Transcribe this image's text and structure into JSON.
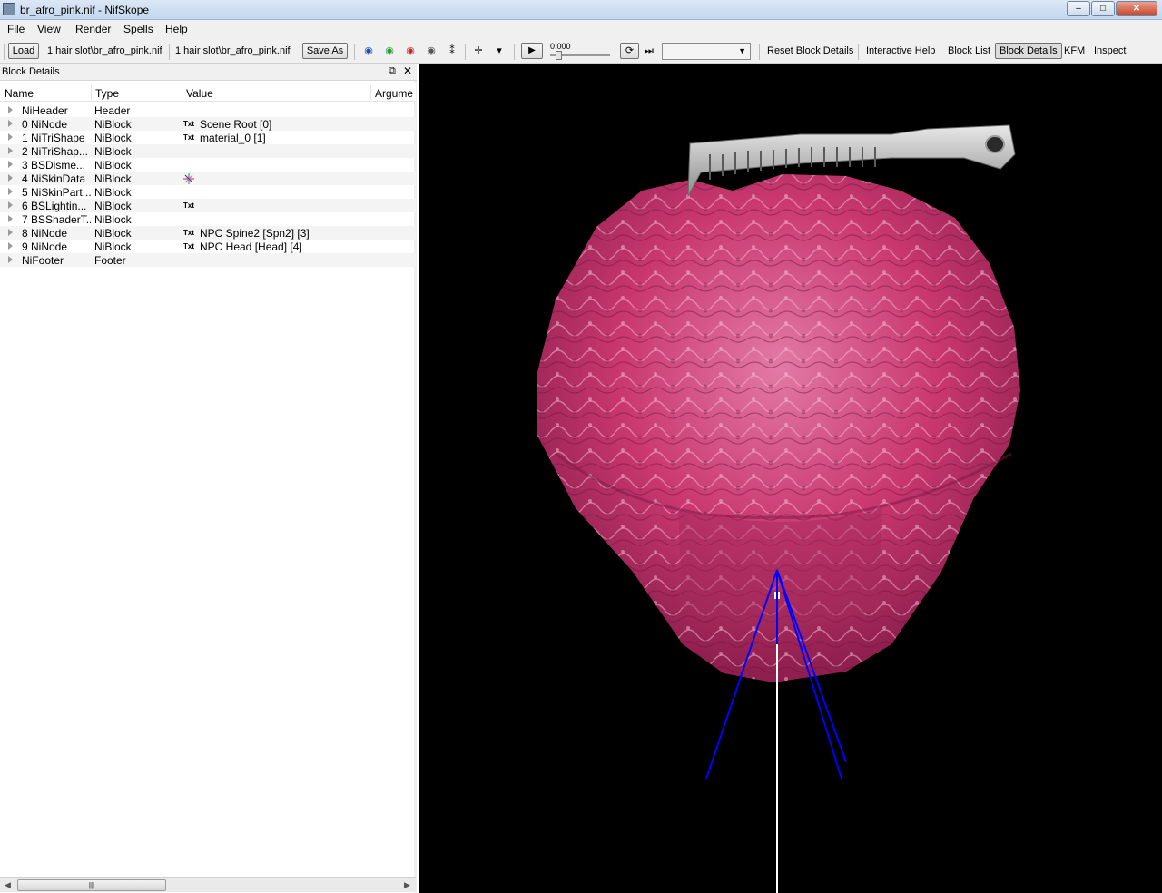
{
  "window": {
    "title": "br_afro_pink.nif - NifSkope",
    "min": "–",
    "max": "□",
    "close": "✕"
  },
  "menu": {
    "file": {
      "hot": "F",
      "rest": "ile"
    },
    "view": {
      "hot": "V",
      "rest": "iew"
    },
    "render": {
      "hot": "R",
      "rest": "ender"
    },
    "spells": {
      "pre": "S",
      "hot": "p",
      "rest": "ells"
    },
    "help": {
      "hot": "H",
      "rest": "elp"
    }
  },
  "toolbar": {
    "load": "Load",
    "path1": "1 hair slot\\br_afro_pink.nif",
    "path2": "1 hair slot\\br_afro_pink.nif",
    "save_as": "Save As",
    "time_value": "0.000",
    "reset": "Reset Block Details",
    "interactive_help": "Interactive Help",
    "block_list": "Block List",
    "block_details": "Block Details",
    "kfm": "KFM",
    "inspect": "Inspect"
  },
  "panel": {
    "title": "Block Details",
    "columns": [
      "Name",
      "Type",
      "Value",
      "Argume"
    ],
    "rows": [
      {
        "name": "NiHeader",
        "type": "Header",
        "txt": "",
        "value": ""
      },
      {
        "name": "0 NiNode",
        "type": "NiBlock",
        "txt": "Txt",
        "value": "Scene Root [0]"
      },
      {
        "name": "1 NiTriShape",
        "type": "NiBlock",
        "txt": "Txt",
        "value": "material_0 [1]"
      },
      {
        "name": "2 NiTriShap...",
        "type": "NiBlock",
        "txt": "",
        "value": ""
      },
      {
        "name": "3 BSDisme...",
        "type": "NiBlock",
        "txt": "",
        "value": ""
      },
      {
        "name": "4 NiSkinData",
        "type": "NiBlock",
        "txt": "",
        "value": ""
      },
      {
        "name": "5 NiSkinPart...",
        "type": "NiBlock",
        "txt": "",
        "value": ""
      },
      {
        "name": "6 BSLightin...",
        "type": "NiBlock",
        "txt": "Txt",
        "value": ""
      },
      {
        "name": "7 BSShaderT...",
        "type": "NiBlock",
        "txt": "",
        "value": ""
      },
      {
        "name": "8 NiNode",
        "type": "NiBlock",
        "txt": "Txt",
        "value": "NPC Spine2 [Spn2] [3]"
      },
      {
        "name": "9 NiNode",
        "type": "NiBlock",
        "txt": "Txt",
        "value": "NPC Head [Head] [4]"
      },
      {
        "name": "NiFooter",
        "type": "Footer",
        "txt": "",
        "value": ""
      }
    ]
  },
  "colors": {
    "hair": "#c9386f",
    "comb": "#c8c8c8",
    "skeleton": "#0000ff",
    "viewport_bg": "#000000"
  }
}
